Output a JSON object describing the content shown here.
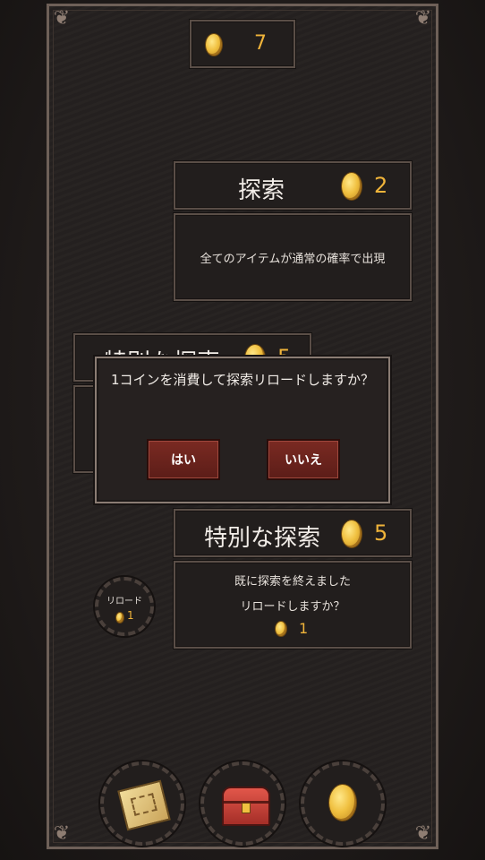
{
  "coin_counter": {
    "value": "7"
  },
  "search_card": {
    "title": "探索",
    "cost": "2",
    "description": "全てのアイテムが通常の確率で出現"
  },
  "special_card_behind": {
    "title": "特別な探索",
    "cost": "5"
  },
  "dialog": {
    "message": "1コインを消費して探索リロードしますか？",
    "yes_label": "はい",
    "no_label": "いいえ"
  },
  "special_card": {
    "title": "特別な探索",
    "cost": "5",
    "message_line1": "既に探索を終えました",
    "message_line2": "リロードしますか？",
    "reload_cost": "1"
  },
  "reload_button": {
    "label": "リロード",
    "cost": "1"
  },
  "bottom_nav": [
    {
      "icon": "map-scroll-icon"
    },
    {
      "icon": "treasure-chest-icon"
    },
    {
      "icon": "gold-coin-icon"
    }
  ],
  "colors": {
    "accent_gold": "#f0b43a",
    "button_red": "#6e241e",
    "panel_border": "#5a4e47"
  }
}
